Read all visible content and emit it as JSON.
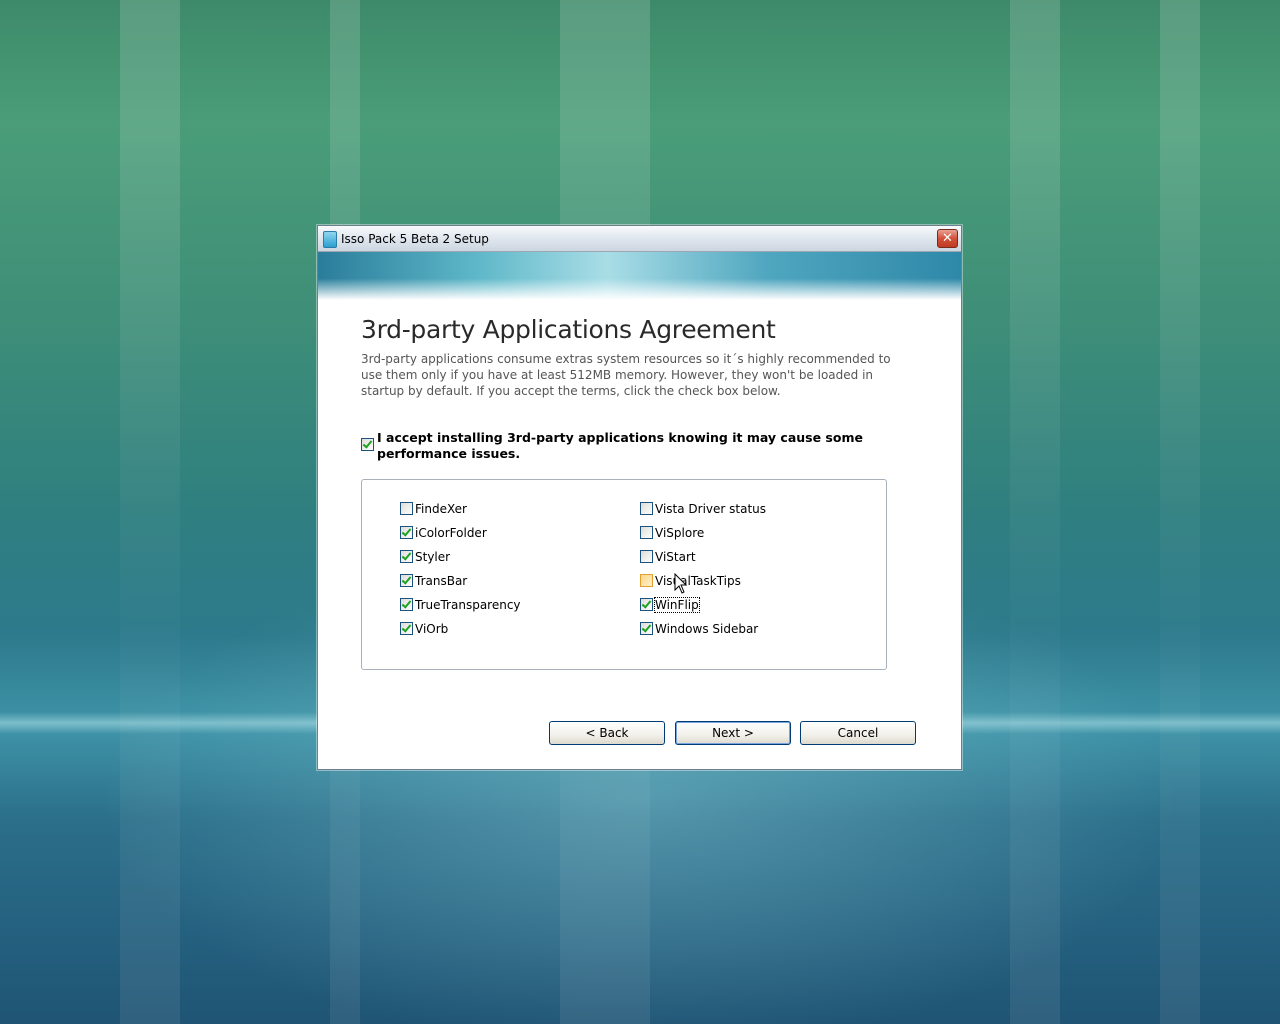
{
  "window": {
    "title": "Isso Pack 5 Beta 2 Setup"
  },
  "page": {
    "title": "3rd-party Applications Agreement",
    "description": "3rd-party applications consume extras system resources so it´s highly recommended to use them only if you have at least 512MB memory. However, they won't be loaded in startup by default. If you accept the terms, click the check box below."
  },
  "accept": {
    "label": "I accept installing 3rd-party applications knowing it may cause some performance issues.",
    "checked": true
  },
  "apps": {
    "left": [
      {
        "label": "FindeXer",
        "checked": false
      },
      {
        "label": "iColorFolder",
        "checked": true
      },
      {
        "label": "Styler",
        "checked": true
      },
      {
        "label": "TransBar",
        "checked": true
      },
      {
        "label": "TrueTransparency",
        "checked": true
      },
      {
        "label": "ViOrb",
        "checked": true
      }
    ],
    "right": [
      {
        "label": "Vista Driver status",
        "checked": false
      },
      {
        "label": "ViSplore",
        "checked": false
      },
      {
        "label": "ViStart",
        "checked": false
      },
      {
        "label": "VisualTaskTips",
        "checked": false
      },
      {
        "label": "WinFlip",
        "checked": true
      },
      {
        "label": "Windows Sidebar",
        "checked": true
      }
    ]
  },
  "buttons": {
    "back": "< Back",
    "next": "Next >",
    "cancel": "Cancel"
  },
  "icons": {
    "close": "close-icon",
    "app": "setup-app-icon",
    "cursor": "mouse-pointer-icon"
  }
}
